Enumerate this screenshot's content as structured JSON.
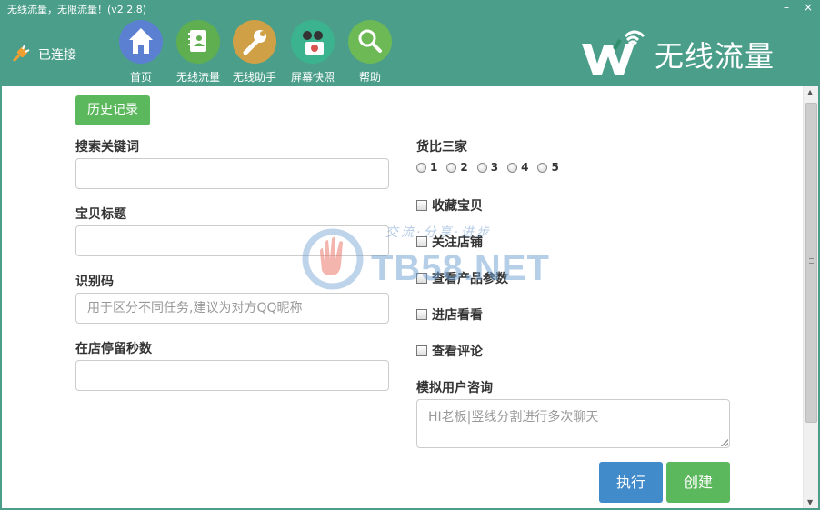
{
  "window": {
    "title": "无线流量，无限流量！(v2.2.8)",
    "minimize_glyph": "–",
    "close_glyph": "×"
  },
  "connection": {
    "status": "已连接",
    "icon": "plug-icon"
  },
  "nav": [
    {
      "label": "首页",
      "icon": "home-icon",
      "color": "#5b7fd1"
    },
    {
      "label": "无线流量",
      "icon": "contacts-icon",
      "color": "#5fae4f"
    },
    {
      "label": "无线助手",
      "icon": "wrench-icon",
      "color": "#d0a046"
    },
    {
      "label": "屏幕快照",
      "icon": "camera-icon",
      "color": "#3bb38e"
    },
    {
      "label": "帮助",
      "icon": "search-icon",
      "color": "#6cb955"
    }
  ],
  "brand": {
    "text": "无线流量",
    "logo": "w-wifi-logo"
  },
  "form": {
    "history_button": "历史记录",
    "keyword_label": "搜索关键词",
    "keyword_value": "",
    "title_label": "宝贝标题",
    "title_value": "",
    "code_label": "识别码",
    "code_placeholder": "用于区分不同任务,建议为对方QQ昵称",
    "stay_label": "在店停留秒数",
    "stay_value": "",
    "compare_label": "货比三家",
    "compare_options": [
      "1",
      "2",
      "3",
      "4",
      "5"
    ],
    "checks": [
      "收藏宝贝",
      "关注店铺",
      "查看产品参数",
      "进店看看",
      "查看评论"
    ],
    "consult_label": "模拟用户咨询",
    "consult_placeholder": "HI老板|竖线分割进行多次聊天",
    "exec_button": "执行",
    "create_button": "创建"
  },
  "watermark": {
    "main": "TB58.NET",
    "sub": "交流·分享·进步"
  },
  "colors": {
    "header": "#4b9f8a",
    "success": "#5cb85c",
    "primary": "#428bca"
  }
}
